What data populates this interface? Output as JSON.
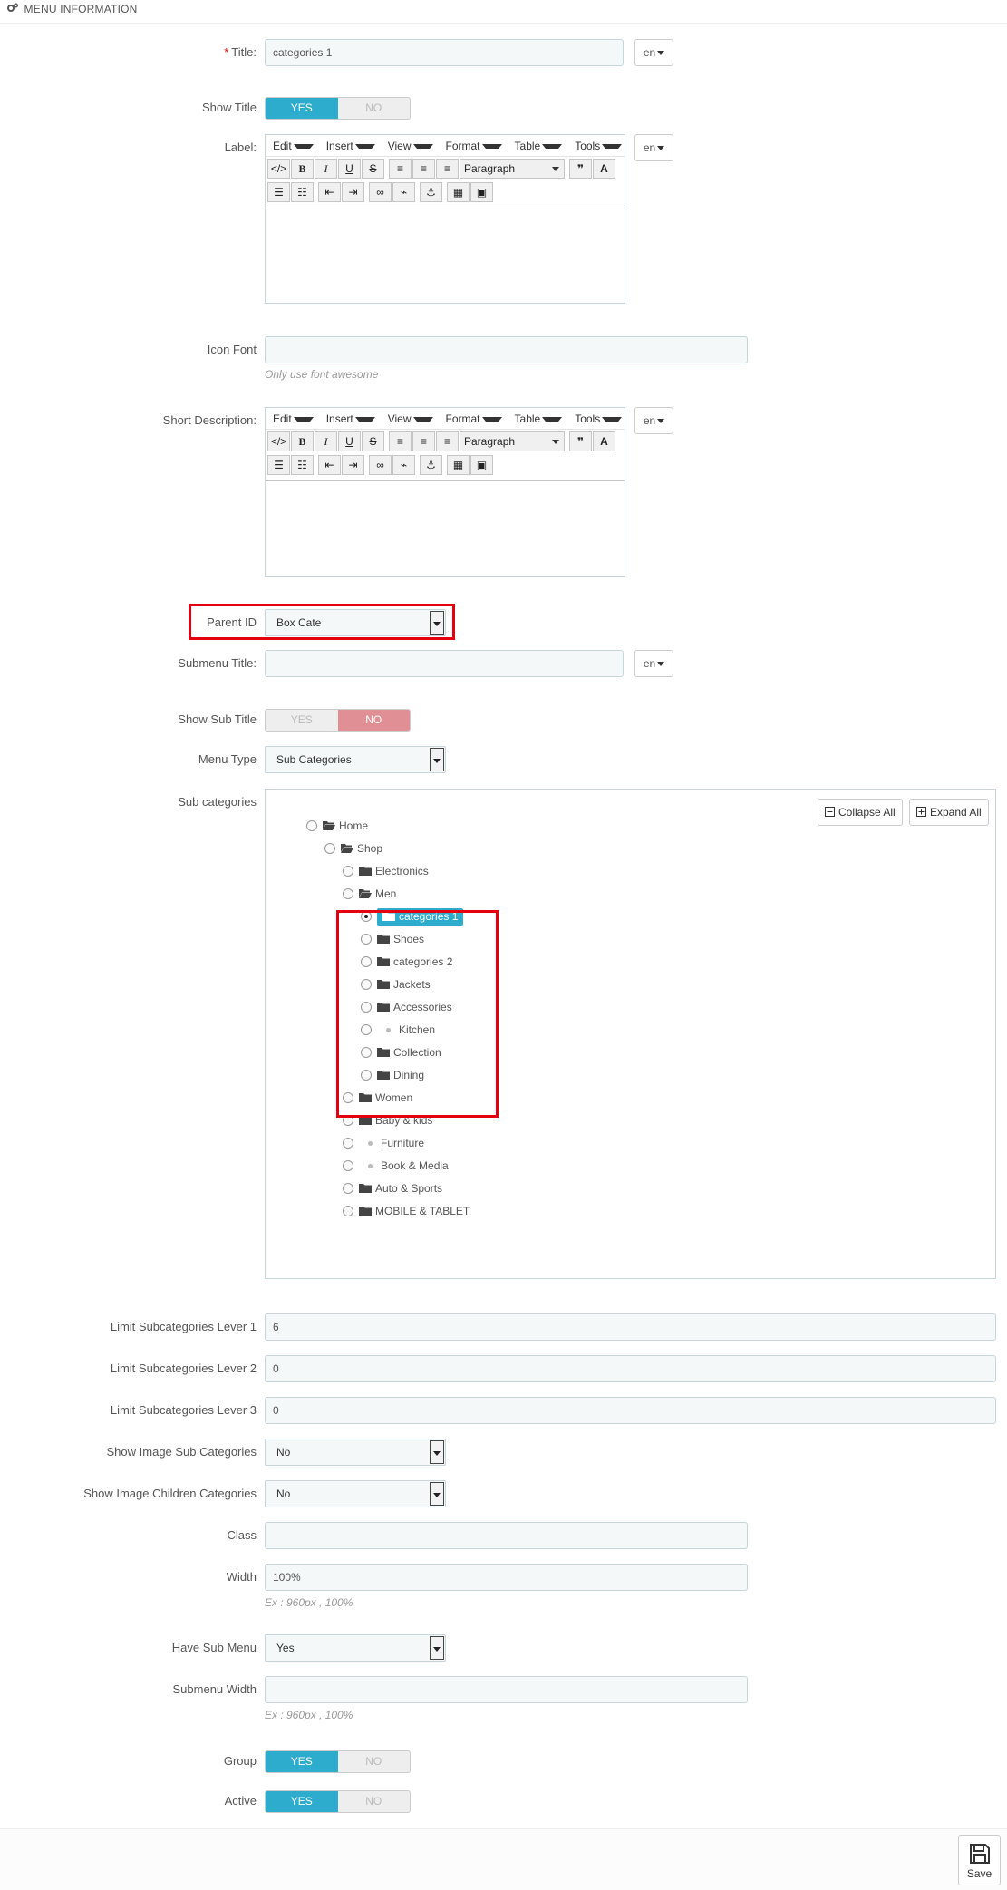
{
  "header": {
    "title": "MENU INFORMATION",
    "icon": "gears-icon"
  },
  "title_field": {
    "label": "Title:",
    "required_mark": "*",
    "value": "categories 1",
    "lang": "en"
  },
  "show_title": {
    "label": "Show Title",
    "yes": "YES",
    "no": "NO",
    "value": "YES"
  },
  "label_field": {
    "label": "Label:",
    "lang": "en"
  },
  "editor": {
    "menus": [
      "Edit",
      "Insert",
      "View",
      "Format",
      "Table",
      "Tools"
    ],
    "paragraph": "Paragraph"
  },
  "icon_font": {
    "label": "Icon Font",
    "value": "",
    "hint": "Only use font awesome"
  },
  "short_description": {
    "label": "Short Description:",
    "lang": "en"
  },
  "parent_id": {
    "label": "Parent ID",
    "value": "Box Cate"
  },
  "submenu_title": {
    "label": "Submenu Title:",
    "value": "",
    "lang": "en"
  },
  "show_sub_title": {
    "label": "Show Sub Title",
    "yes": "YES",
    "no": "NO",
    "value": "NO"
  },
  "menu_type": {
    "label": "Menu Type",
    "value": "Sub Categories"
  },
  "sub_categories": {
    "label": "Sub categories",
    "collapse_all": "Collapse All",
    "expand_all": "Expand All",
    "tree": [
      {
        "label": "Home",
        "level": 0,
        "kind": "folder-open",
        "checked": false
      },
      {
        "label": "Shop",
        "level": 1,
        "kind": "folder-open",
        "checked": false
      },
      {
        "label": "Electronics",
        "level": 2,
        "kind": "folder",
        "checked": false
      },
      {
        "label": "Men",
        "level": 2,
        "kind": "folder-open",
        "checked": false
      },
      {
        "label": "categories 1",
        "level": 3,
        "kind": "folder",
        "checked": true,
        "selected": true
      },
      {
        "label": "Shoes",
        "level": 3,
        "kind": "folder",
        "checked": false
      },
      {
        "label": "categories 2",
        "level": 3,
        "kind": "folder",
        "checked": false
      },
      {
        "label": "Jackets",
        "level": 3,
        "kind": "folder",
        "checked": false
      },
      {
        "label": "Accessories",
        "level": 3,
        "kind": "folder",
        "checked": false
      },
      {
        "label": "Kitchen",
        "level": 3,
        "kind": "leaf",
        "checked": false
      },
      {
        "label": "Collection",
        "level": 3,
        "kind": "folder",
        "checked": false
      },
      {
        "label": "Dining",
        "level": 3,
        "kind": "folder",
        "checked": false
      },
      {
        "label": "Women",
        "level": 2,
        "kind": "folder",
        "checked": false
      },
      {
        "label": "Baby & kids",
        "level": 2,
        "kind": "folder",
        "checked": false
      },
      {
        "label": "Furniture",
        "level": 2,
        "kind": "leaf",
        "checked": false
      },
      {
        "label": "Book & Media",
        "level": 2,
        "kind": "leaf",
        "checked": false
      },
      {
        "label": "Auto & Sports",
        "level": 2,
        "kind": "folder",
        "checked": false
      },
      {
        "label": "MOBILE & TABLET.",
        "level": 2,
        "kind": "folder",
        "checked": false
      }
    ]
  },
  "limit1": {
    "label": "Limit Subcategories Lever 1",
    "value": "6"
  },
  "limit2": {
    "label": "Limit Subcategories Lever 2",
    "value": "0"
  },
  "limit3": {
    "label": "Limit Subcategories Lever 3",
    "value": "0"
  },
  "show_image_sub": {
    "label": "Show Image Sub Categories",
    "value": "No"
  },
  "show_image_children": {
    "label": "Show Image Children Categories",
    "value": "No"
  },
  "class_field": {
    "label": "Class",
    "value": ""
  },
  "width_field": {
    "label": "Width",
    "value": "100%",
    "hint": "Ex : 960px , 100%"
  },
  "have_sub_menu": {
    "label": "Have Sub Menu",
    "value": "Yes"
  },
  "submenu_width": {
    "label": "Submenu Width",
    "value": "",
    "hint": "Ex : 960px , 100%"
  },
  "group": {
    "label": "Group",
    "yes": "YES",
    "no": "NO",
    "value": "YES"
  },
  "active": {
    "label": "Active",
    "yes": "YES",
    "no": "NO",
    "value": "YES"
  },
  "footer": {
    "save_label": "Save"
  },
  "colors": {
    "accent": "#2eacce",
    "no_active": "#e08f95",
    "highlight": "#e3000f"
  }
}
